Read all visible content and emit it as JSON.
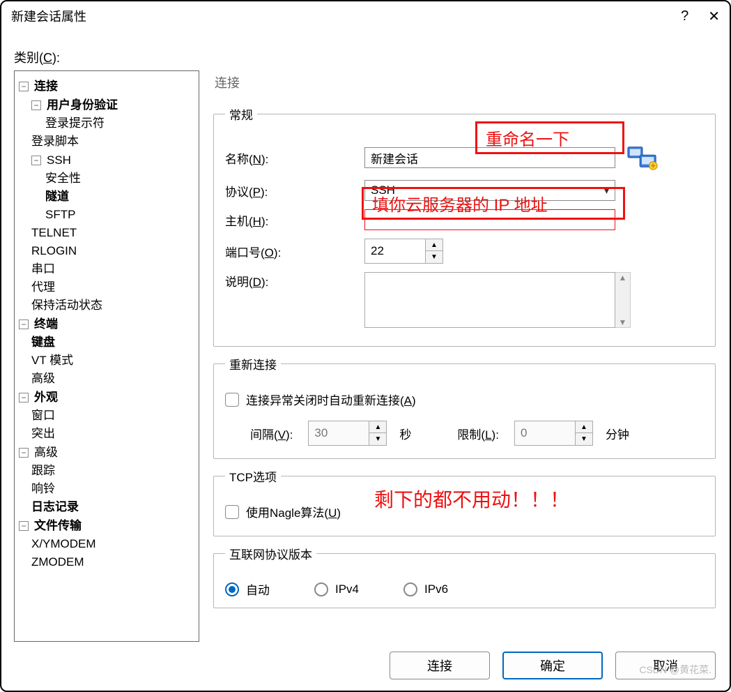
{
  "titlebar": {
    "title": "新建会话属性",
    "help": "?",
    "close": "✕"
  },
  "category_label": "类别(C):",
  "tree": {
    "connection": "连接",
    "user_auth": "用户身份验证",
    "login_prompt": "登录提示符",
    "login_script": "登录脚本",
    "ssh": "SSH",
    "security": "安全性",
    "tunnel": "隧道",
    "sftp": "SFTP",
    "telnet": "TELNET",
    "rlogin": "RLOGIN",
    "serial": "串口",
    "proxy": "代理",
    "keepalive": "保持活动状态",
    "terminal": "终端",
    "keyboard": "键盘",
    "vt_mode": "VT 模式",
    "advanced_term": "高级",
    "appearance": "外观",
    "window": "窗口",
    "popup": "突出",
    "advanced": "高级",
    "trace": "跟踪",
    "bell": "响铃",
    "logging": "日志记录",
    "file_transfer": "文件传输",
    "xymodem": "X/YMODEM",
    "zmodem": "ZMODEM"
  },
  "content": {
    "heading": "连接",
    "general": {
      "legend": "常规",
      "name_label": "名称(N):",
      "name_value": "新建会话",
      "protocol_label": "协议(P):",
      "protocol_value": "SSH",
      "host_label": "主机(H):",
      "host_value": "",
      "port_label": "端口号(O):",
      "port_value": "22",
      "desc_label": "说明(D):",
      "desc_value": ""
    },
    "reconnect": {
      "legend": "重新连接",
      "auto_label": "连接异常关闭时自动重新连接(A)",
      "interval_label": "间隔(V):",
      "interval_value": "30",
      "interval_unit": "秒",
      "limit_label": "限制(L):",
      "limit_value": "0",
      "limit_unit": "分钟"
    },
    "tcp": {
      "legend": "TCP选项",
      "nagle_label": "使用Nagle算法(U)"
    },
    "ipver": {
      "legend": "互联网协议版本",
      "auto": "自动",
      "ipv4": "IPv4",
      "ipv6": "IPv6"
    }
  },
  "annotations": {
    "rename": "重命名一下",
    "fill_ip": "填你云服务器的 IP 地址",
    "rest": "剩下的都不用动！！！"
  },
  "footer": {
    "connect": "连接",
    "ok": "确定",
    "cancel": "取消"
  },
  "watermark": "CSDN @黄花菜."
}
